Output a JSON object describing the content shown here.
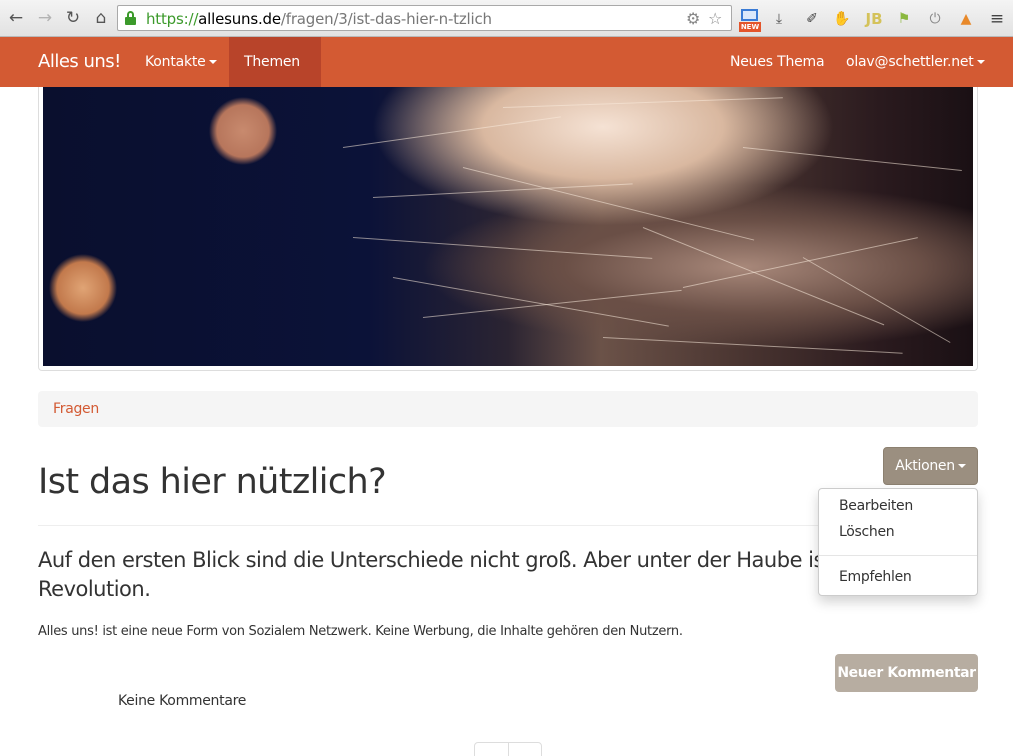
{
  "browser": {
    "url_scheme": "https://",
    "url_host": "allesuns.de",
    "url_path": "/fragen/3/ist-das-hier-n-tzlich",
    "new_badge": "NEW"
  },
  "navbar": {
    "brand": "Alles uns!",
    "items": [
      {
        "label": "Kontakte"
      },
      {
        "label": "Themen"
      }
    ],
    "right_items": [
      {
        "label": "Neues Thema"
      },
      {
        "label": "olav@schettler.net"
      }
    ],
    "accent_color": "#d35a33"
  },
  "breadcrumb": {
    "items": [
      "Fragen"
    ]
  },
  "article": {
    "title": "Ist das hier nützlich?",
    "lead": "Auf den ersten Blick sind die Unterschiede nicht groß. Aber unter der Haube ist Alles eine Revolution.",
    "description": "Alles uns! ist eine neue Form von Sozialem Netzwerk. Keine Werbung, die Inhalte gehören den Nutzern."
  },
  "actions": {
    "button_label": "Aktionen",
    "menu": [
      "Bearbeiten",
      "Löschen",
      "Empfehlen"
    ]
  },
  "comments": {
    "new_button": "Neuer Kommentar",
    "empty_text": "Keine Kommentare"
  }
}
